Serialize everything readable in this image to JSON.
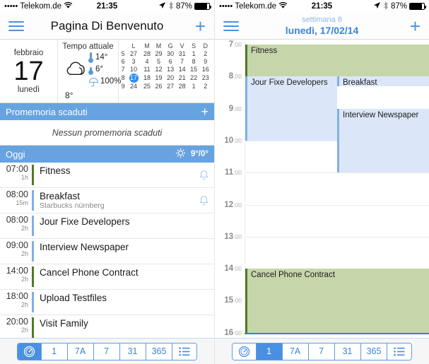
{
  "status_bar": {
    "signal_dots": "•••••",
    "carrier": "Telekom.de",
    "wifi_icon": "wifi-icon",
    "time": "21:35",
    "location_icon": "location-arrow-icon",
    "bluetooth_icon": "bluetooth-icon",
    "battery_pct": "87%",
    "battery_level": 87
  },
  "left": {
    "navbar": {
      "menu_icon": "hamburger-menu-icon",
      "title": "Pagina Di Benvenuto",
      "add_icon": "+"
    },
    "widget": {
      "month": "febbraio",
      "day_number": "17",
      "weekday": "lunedì",
      "weather_title": "Tempo attuale",
      "weather_icon": "cloud-icon",
      "high_temp": "14°",
      "low_temp": "6°",
      "current_temp": "8°",
      "precipitation": "100%",
      "thermometer_high_icon": "thermometer-high-icon",
      "thermometer_low_icon": "thermometer-low-icon",
      "umbrella_icon": "umbrella-icon",
      "mini_calendar": {
        "weekday_headers": [
          "L",
          "M",
          "M",
          "G",
          "V",
          "S",
          "D"
        ],
        "weeks": [
          {
            "num": "5",
            "days": [
              {
                "d": "27",
                "t": "out"
              },
              {
                "d": "28",
                "t": "out"
              },
              {
                "d": "29",
                "t": "out"
              },
              {
                "d": "30",
                "t": "out"
              },
              {
                "d": "31",
                "t": "out"
              },
              {
                "d": "1",
                "t": "norm"
              },
              {
                "d": "2",
                "t": "we"
              }
            ]
          },
          {
            "num": "6",
            "days": [
              {
                "d": "3",
                "t": "norm"
              },
              {
                "d": "4",
                "t": "norm"
              },
              {
                "d": "5",
                "t": "norm"
              },
              {
                "d": "6",
                "t": "norm"
              },
              {
                "d": "7",
                "t": "norm"
              },
              {
                "d": "8",
                "t": "norm"
              },
              {
                "d": "9",
                "t": "we"
              }
            ]
          },
          {
            "num": "7",
            "days": [
              {
                "d": "10",
                "t": "norm"
              },
              {
                "d": "11",
                "t": "norm"
              },
              {
                "d": "12",
                "t": "norm"
              },
              {
                "d": "13",
                "t": "norm"
              },
              {
                "d": "14",
                "t": "norm"
              },
              {
                "d": "15",
                "t": "norm"
              },
              {
                "d": "16",
                "t": "we"
              }
            ]
          },
          {
            "num": "8",
            "days": [
              {
                "d": "17",
                "t": "today"
              },
              {
                "d": "18",
                "t": "dim"
              },
              {
                "d": "19",
                "t": "dim"
              },
              {
                "d": "20",
                "t": "dim"
              },
              {
                "d": "21",
                "t": "dim"
              },
              {
                "d": "22",
                "t": "dim"
              },
              {
                "d": "23",
                "t": "we"
              }
            ]
          },
          {
            "num": "9",
            "days": [
              {
                "d": "24",
                "t": "norm"
              },
              {
                "d": "25",
                "t": "norm"
              },
              {
                "d": "26",
                "t": "norm"
              },
              {
                "d": "27",
                "t": "norm"
              },
              {
                "d": "28",
                "t": "norm"
              },
              {
                "d": "1",
                "t": "out"
              },
              {
                "d": "2",
                "t": "out"
              }
            ]
          }
        ]
      }
    },
    "reminders_section": {
      "title": "Promemoria scaduti",
      "add_icon": "+",
      "empty_text": "Nessun promemoria scaduti"
    },
    "today_section": {
      "title": "Oggi",
      "weather_icon": "sun-icon",
      "temps": "9°/0°"
    },
    "events": [
      {
        "time": "07:00",
        "duration": "1h",
        "title": "Fitness",
        "subtitle": "",
        "color": "#4f7a28",
        "alarm": true
      },
      {
        "time": "08:00",
        "duration": "15m",
        "title": "Breakfast",
        "subtitle": "Starbucks nürnberg",
        "color": "#7fb0e8",
        "alarm": true
      },
      {
        "time": "08:00",
        "duration": "2h",
        "title": "Jour Fixe Developers",
        "subtitle": "",
        "color": "#7fb0e8",
        "alarm": false
      },
      {
        "time": "09:00",
        "duration": "2h",
        "title": "Interview Newspaper",
        "subtitle": "",
        "color": "#7fb0e8",
        "alarm": false
      },
      {
        "time": "14:00",
        "duration": "2h",
        "title": "Cancel Phone Contract",
        "subtitle": "",
        "color": "#4f7a28",
        "alarm": false
      },
      {
        "time": "18:00",
        "duration": "2h",
        "title": "Upload Testfiles",
        "subtitle": "",
        "color": "#7fb0e8",
        "alarm": false
      },
      {
        "time": "20:00",
        "duration": "2h",
        "title": "Visit Family",
        "subtitle": "",
        "color": "#4f7a28",
        "alarm": false
      }
    ],
    "toolbar": {
      "items": [
        {
          "label": "",
          "icon": "dashboard-gauge-icon",
          "active": true
        },
        {
          "label": "1",
          "icon": "",
          "active": false
        },
        {
          "label": "7A",
          "icon": "",
          "active": false
        },
        {
          "label": "7",
          "icon": "",
          "active": false
        },
        {
          "label": "31",
          "icon": "",
          "active": false
        },
        {
          "label": "365",
          "icon": "",
          "active": false
        },
        {
          "label": "",
          "icon": "list-icon",
          "active": false
        }
      ]
    }
  },
  "right": {
    "navbar": {
      "menu_icon": "hamburger-menu-icon",
      "subtitle": "settimana 8",
      "title": "lunedì, 17/02/14",
      "add_icon": "+"
    },
    "day_view": {
      "hours": [
        "7",
        "8",
        "9",
        "10",
        "11",
        "12",
        "13",
        "14",
        "15",
        "16"
      ],
      "hour_minute_suffix": ":00",
      "blocks": [
        {
          "title": "Fitness",
          "start": 7,
          "end": 8,
          "col": 0,
          "cols": 1,
          "fill": "#c6d6ab",
          "bar": "#4f7a28"
        },
        {
          "title": "Jour Fixe Developers",
          "start": 8,
          "end": 10,
          "col": 0,
          "cols": 2,
          "fill": "#dbe7f9",
          "bar": "#7fb0e8"
        },
        {
          "title": "Breakfast",
          "start": 8,
          "end": 8.25,
          "col": 1,
          "cols": 2,
          "fill": "#dbe7f9",
          "bar": "#7fb0e8"
        },
        {
          "title": "Interview Newspaper",
          "start": 9,
          "end": 11,
          "col": 1,
          "cols": 2,
          "fill": "#dbe7f9",
          "bar": "#7fb0e8"
        },
        {
          "title": "Cancel Phone Contract",
          "start": 14,
          "end": 16,
          "col": 0,
          "cols": 1,
          "fill": "#c6d6ab",
          "bar": "#4f7a28"
        }
      ],
      "now_line_hour": 16
    },
    "toolbar": {
      "items": [
        {
          "label": "",
          "icon": "dashboard-gauge-icon",
          "active": false
        },
        {
          "label": "1",
          "icon": "",
          "active": true
        },
        {
          "label": "7A",
          "icon": "",
          "active": false
        },
        {
          "label": "7",
          "icon": "",
          "active": false
        },
        {
          "label": "31",
          "icon": "",
          "active": false
        },
        {
          "label": "365",
          "icon": "",
          "active": false
        },
        {
          "label": "",
          "icon": "list-icon",
          "active": false
        }
      ]
    }
  },
  "colors": {
    "accent_blue": "#4a90e2",
    "section_blue": "#66a3e0",
    "event_green": "#4f7a28",
    "event_blue": "#7fb0e8",
    "block_green_fill": "#c6d6ab",
    "block_blue_fill": "#dbe7f9",
    "weekend_red": "#d84a3a"
  }
}
